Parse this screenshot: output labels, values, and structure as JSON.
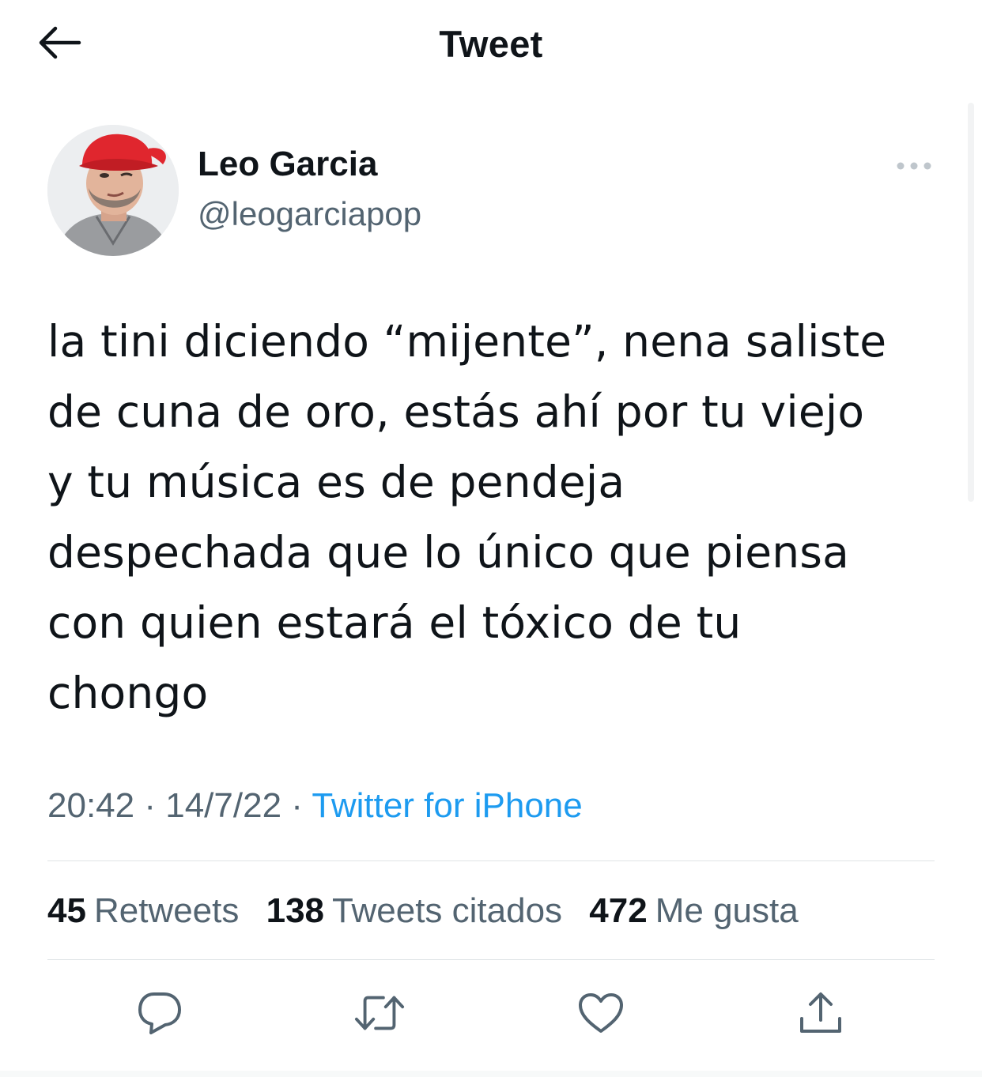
{
  "header": {
    "title": "Tweet",
    "back_icon": "arrow-left-icon"
  },
  "author": {
    "display_name": "Leo Garcia",
    "handle": "@leogarciapop"
  },
  "tweet": {
    "text": "la tini diciendo “mijente”, nena saliste\nde cuna de oro, estás ahí por tu viejo\ny tu música es de pendeja\ndespechada que lo único que piensa\ncon quien estará el tóxico de tu\nchongo",
    "time": "20:42",
    "date": "14/7/22",
    "separator": "·",
    "source": "Twitter for iPhone"
  },
  "stats": {
    "retweets_count": "45",
    "retweets_label": "Retweets",
    "quotes_count": "138",
    "quotes_label": "Tweets citados",
    "likes_count": "472",
    "likes_label": "Me gusta"
  },
  "actions": {
    "reply_icon": "reply-icon",
    "retweet_icon": "retweet-icon",
    "like_icon": "heart-icon",
    "share_icon": "share-icon"
  },
  "colors": {
    "text": "#0f1419",
    "secondary": "#536471",
    "link": "#1d9bf0",
    "divider": "#dfe3e6"
  }
}
